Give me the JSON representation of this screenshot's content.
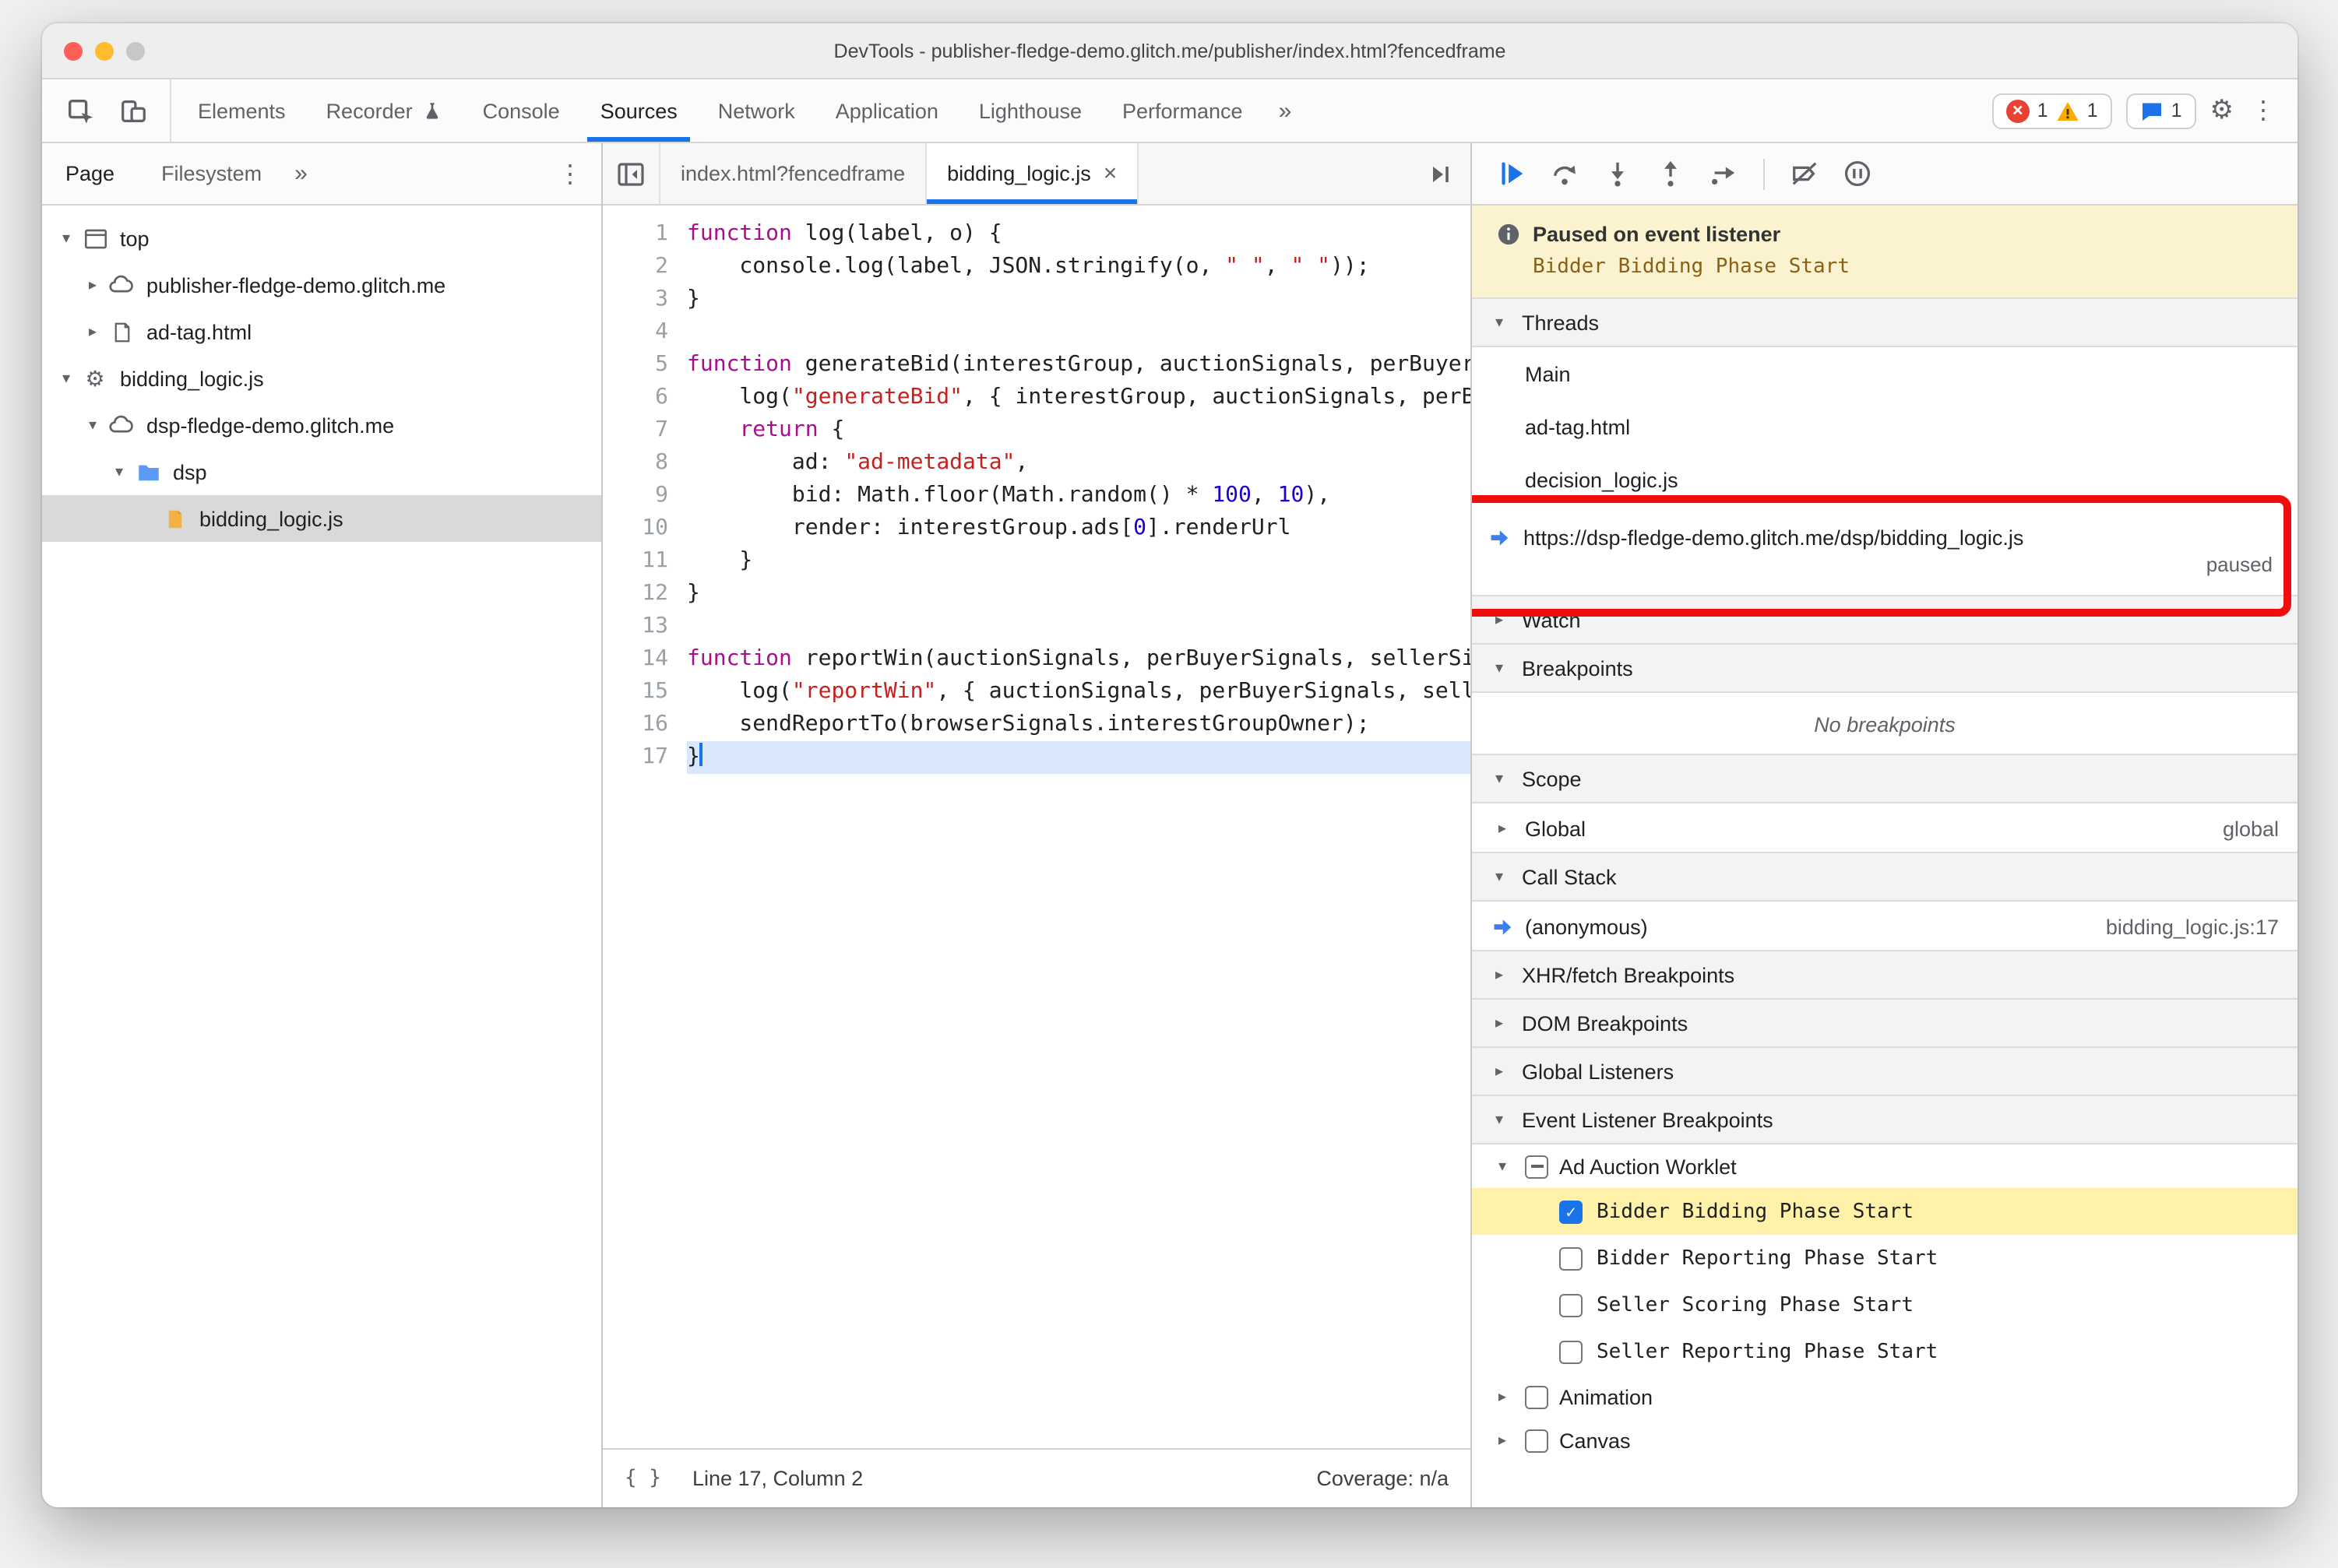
{
  "window": {
    "title": "DevTools - publisher-fledge-demo.glitch.me/publisher/index.html?fencedframe"
  },
  "toolbar": {
    "tabs": [
      {
        "label": "Elements"
      },
      {
        "label": "Recorder",
        "icon": "flask"
      },
      {
        "label": "Console"
      },
      {
        "label": "Sources",
        "active": true
      },
      {
        "label": "Network"
      },
      {
        "label": "Application"
      },
      {
        "label": "Lighthouse"
      },
      {
        "label": "Performance"
      }
    ],
    "more": "»",
    "error_count": "1",
    "warning_count": "1",
    "issues_count": "1"
  },
  "sidebar": {
    "tabs": [
      {
        "label": "Page",
        "active": true
      },
      {
        "label": "Filesystem"
      }
    ],
    "more": "»",
    "tree": [
      {
        "depth": 0,
        "arrow": "down",
        "icon": "frame",
        "label": "top"
      },
      {
        "depth": 1,
        "arrow": "right",
        "icon": "cloud",
        "label": "publisher-fledge-demo.glitch.me"
      },
      {
        "depth": 1,
        "arrow": "right",
        "icon": "document",
        "label": "ad-tag.html"
      },
      {
        "depth": 0,
        "arrow": "down",
        "icon": "worklet",
        "label": "bidding_logic.js"
      },
      {
        "depth": 1,
        "arrow": "down",
        "icon": "cloud",
        "label": "dsp-fledge-demo.glitch.me"
      },
      {
        "depth": 2,
        "arrow": "down",
        "icon": "folder",
        "label": "dsp"
      },
      {
        "depth": 3,
        "arrow": "none",
        "icon": "file-js",
        "label": "bidding_logic.js",
        "selected": true
      }
    ]
  },
  "editor": {
    "tabs": [
      {
        "label": "index.html?fencedframe"
      },
      {
        "label": "bidding_logic.js",
        "active": true,
        "closable": true
      }
    ],
    "code_lines": [
      {
        "tokens": [
          [
            "k",
            "function"
          ],
          [
            "p",
            " log(label, o) {"
          ]
        ]
      },
      {
        "tokens": [
          [
            "p",
            "    console.log(label, JSON.stringify(o, "
          ],
          [
            "s",
            "\" \""
          ],
          [
            "p",
            ", "
          ],
          [
            "s",
            "\" \""
          ],
          [
            "p",
            "));"
          ]
        ]
      },
      {
        "tokens": [
          [
            "p",
            "}"
          ]
        ]
      },
      {
        "tokens": [
          [
            "p",
            ""
          ]
        ]
      },
      {
        "tokens": [
          [
            "k",
            "function"
          ],
          [
            "p",
            " generateBid(interestGroup, auctionSignals, perBuyerSignals,"
          ]
        ]
      },
      {
        "tokens": [
          [
            "p",
            "    log("
          ],
          [
            "s",
            "\"generateBid\""
          ],
          [
            "p",
            ", { interestGroup, auctionSignals, perBuyerSig"
          ]
        ]
      },
      {
        "tokens": [
          [
            "p",
            "    "
          ],
          [
            "k",
            "return"
          ],
          [
            "p",
            " {"
          ]
        ]
      },
      {
        "tokens": [
          [
            "p",
            "        ad: "
          ],
          [
            "s",
            "\"ad-metadata\""
          ],
          [
            "p",
            ","
          ]
        ]
      },
      {
        "tokens": [
          [
            "p",
            "        bid: Math.floor(Math.random() * "
          ],
          [
            "n",
            "100"
          ],
          [
            "p",
            ", "
          ],
          [
            "n",
            "10"
          ],
          [
            "p",
            "),"
          ]
        ]
      },
      {
        "tokens": [
          [
            "p",
            "        render: interestGroup.ads["
          ],
          [
            "n",
            "0"
          ],
          [
            "p",
            "].renderUrl"
          ]
        ]
      },
      {
        "tokens": [
          [
            "p",
            "    }"
          ]
        ]
      },
      {
        "tokens": [
          [
            "p",
            "}"
          ]
        ]
      },
      {
        "tokens": [
          [
            "p",
            ""
          ]
        ]
      },
      {
        "tokens": [
          [
            "k",
            "function"
          ],
          [
            "p",
            " reportWin(auctionSignals, perBuyerSignals, sellerSignals,"
          ]
        ]
      },
      {
        "tokens": [
          [
            "p",
            "    log("
          ],
          [
            "s",
            "\"reportWin\""
          ],
          [
            "p",
            ", { auctionSignals, perBuyerSignals, sellerSig"
          ]
        ]
      },
      {
        "tokens": [
          [
            "p",
            "    sendReportTo(browserSignals.interestGroupOwner);"
          ]
        ]
      },
      {
        "tokens": [
          [
            "p",
            "}"
          ]
        ],
        "exec": true,
        "caret": true
      }
    ],
    "status": {
      "line_col": "Line 17, Column 2",
      "coverage": "Coverage: n/a"
    }
  },
  "dbg": {
    "banner": {
      "title": "Paused on event listener",
      "subtitle": "Bidder Bidding Phase Start"
    },
    "threads_label": "Threads",
    "threads": [
      {
        "label": "Main"
      },
      {
        "label": "ad-tag.html"
      },
      {
        "label": "decision_logic.js"
      },
      {
        "label": "https://dsp-fledge-demo.glitch.me/dsp/bidding_logic.js",
        "status": "paused",
        "active": true
      }
    ],
    "watch_label": "Watch",
    "breakpoints_label": "Breakpoints",
    "no_breakpoints": "No breakpoints",
    "scope_label": "Scope",
    "scope_rows": [
      {
        "label": "Global",
        "value": "global"
      }
    ],
    "callstack_label": "Call Stack",
    "callstack_rows": [
      {
        "label": "(anonymous)",
        "location": "bidding_logic.js:17"
      }
    ],
    "xhr_label": "XHR/fetch Breakpoints",
    "dom_label": "DOM Breakpoints",
    "global_listeners_label": "Global Listeners",
    "elb_label": "Event Listener Breakpoints",
    "elb_groups": [
      {
        "label": "Ad Auction Worklet",
        "checkbox": "indeterminate",
        "expanded": true,
        "items": [
          {
            "label": "Bidder Bidding Phase Start",
            "checked": true,
            "highlighted": true
          },
          {
            "label": "Bidder Reporting Phase Start",
            "checked": false
          },
          {
            "label": "Seller Scoring Phase Start",
            "checked": false
          },
          {
            "label": "Seller Reporting Phase Start",
            "checked": false
          }
        ]
      },
      {
        "label": "Animation",
        "checkbox": "unchecked",
        "expanded": false,
        "items": []
      },
      {
        "label": "Canvas",
        "checkbox": "unchecked",
        "expanded": false,
        "items": []
      }
    ]
  }
}
